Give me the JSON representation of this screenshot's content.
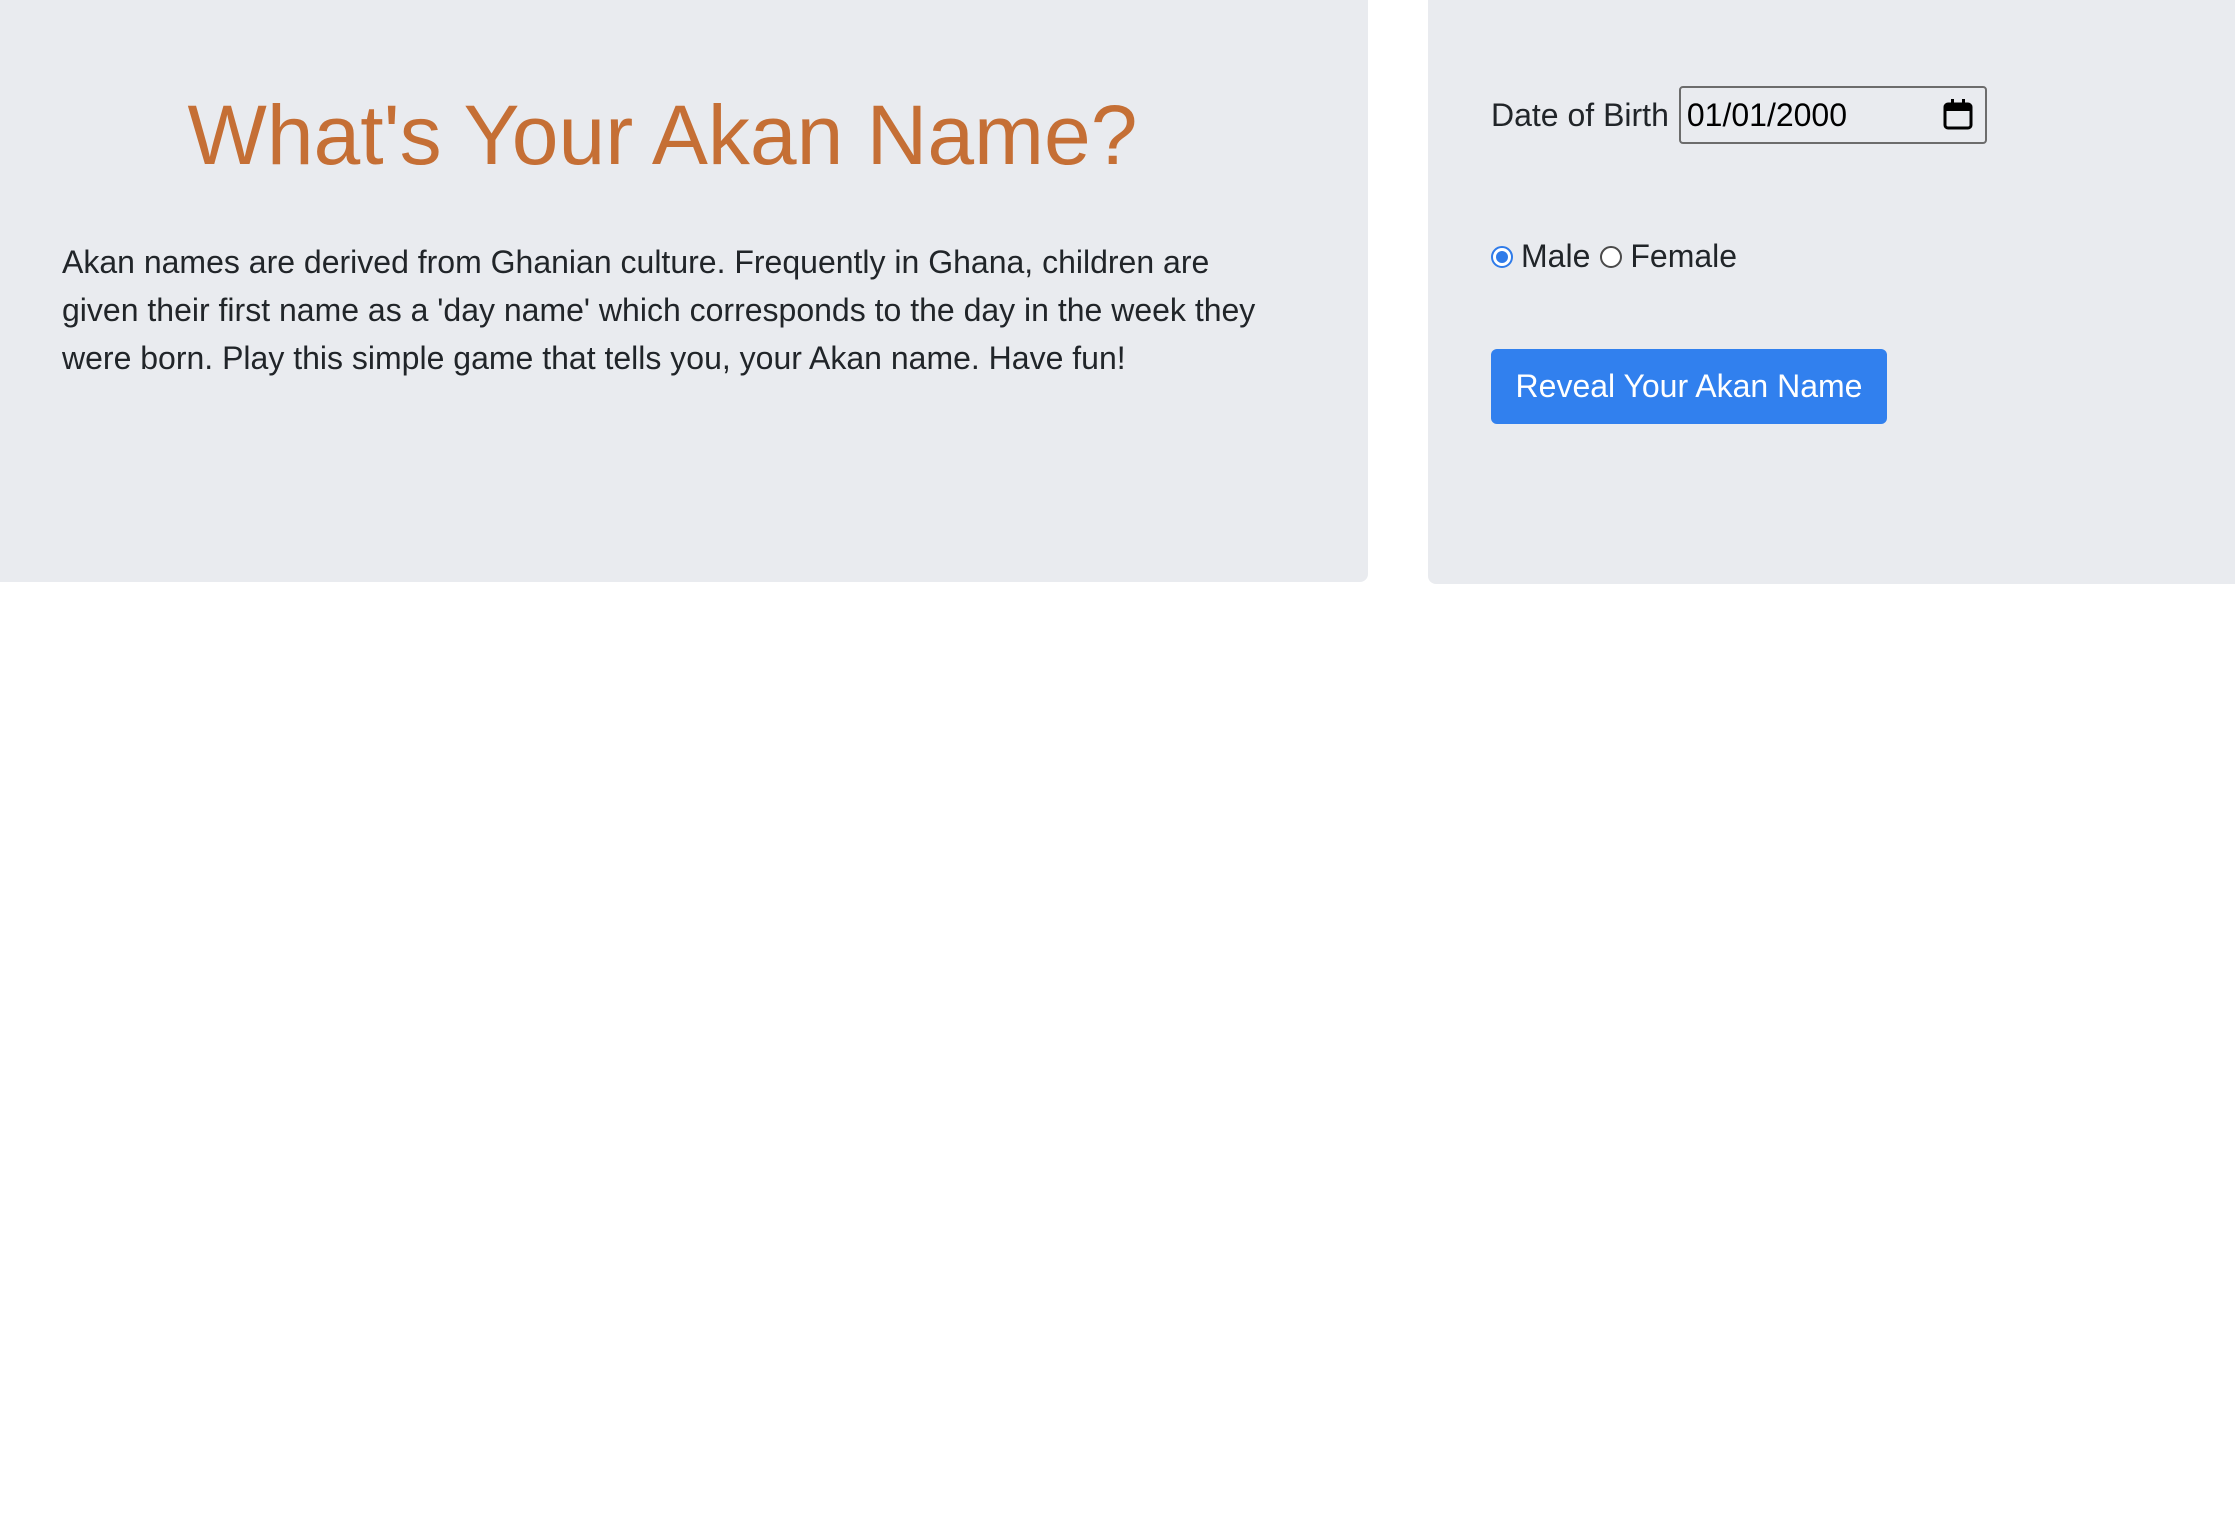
{
  "intro_panel": {
    "title": "What's Your Akan Name?",
    "description": "Akan names are derived from Ghanian culture. Frequently in Ghana, children are given their first name as a 'day name' which corresponds to the day in the week they were born. Play this simple game that tells you, your Akan name. Have fun!"
  },
  "form": {
    "dob_label": "Date of Birth",
    "dob_value": "01/01/2000",
    "gender_options": [
      {
        "label": "Male",
        "selected": true
      },
      {
        "label": "Female",
        "selected": false
      }
    ],
    "submit_label": "Reveal Your Akan Name"
  },
  "colors": {
    "title": "#c56f35",
    "panel_bg": "#e9ebef",
    "button_bg": "#3180ee",
    "radio_selected": "#2f7be9"
  },
  "icons": {
    "date_picker": "calendar-icon"
  }
}
